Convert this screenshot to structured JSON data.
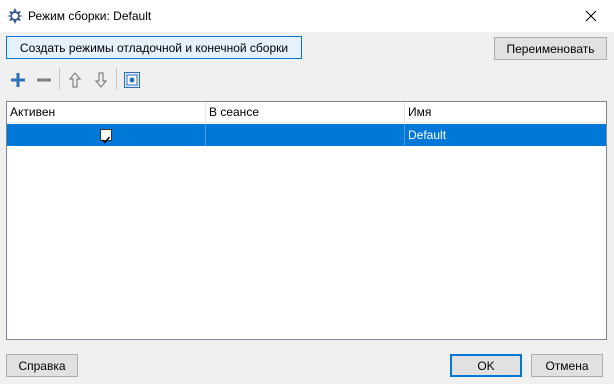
{
  "window": {
    "title": "Режим сборки: Default"
  },
  "toolbar": {
    "create_label": "Создать режимы отладочной и конечной сборки",
    "rename_label": "Переименовать"
  },
  "grid": {
    "columns": [
      "Активен",
      "В сеансе",
      "Имя"
    ],
    "rows": [
      {
        "active": true,
        "in_session": "",
        "name": "Default",
        "selected": true
      }
    ]
  },
  "footer": {
    "help_label": "Справка",
    "ok_label": "OK",
    "cancel_label": "Отмена"
  },
  "colors": {
    "selection": "#0078d7",
    "accent_icon": "#2c6fb5"
  },
  "icons": [
    "app-icon",
    "close-icon",
    "add-icon",
    "remove-icon",
    "move-up-icon",
    "move-down-icon",
    "config-icon",
    "checkmark-icon"
  ]
}
